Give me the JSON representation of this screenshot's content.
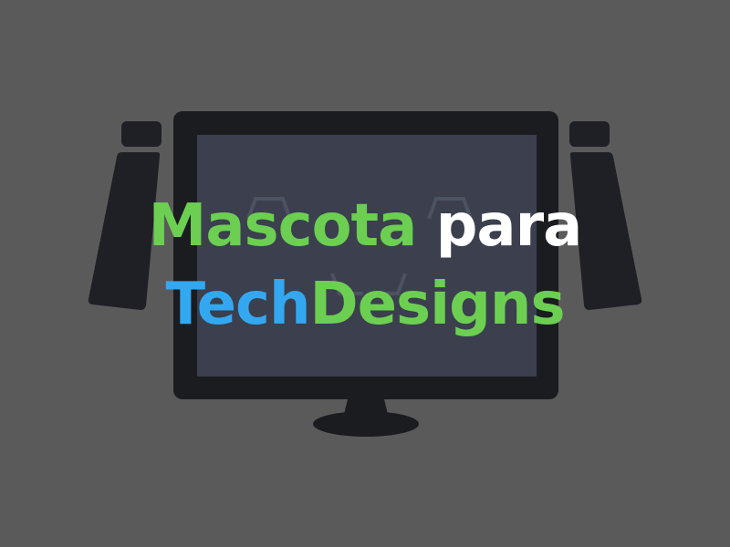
{
  "title": {
    "line1": {
      "word1": "Mascota",
      "word2": "para"
    },
    "line2": {
      "part1": "Tech",
      "part2": "Designs"
    }
  },
  "colors": {
    "background": "#5a5a5a",
    "accent_green": "#6ccf52",
    "accent_blue": "#33a8f0",
    "text_white": "#ffffff",
    "monitor_frame": "#1b1c20",
    "screen": "#3b3f4e"
  },
  "illustration": {
    "icons": [
      "monitor-icon",
      "left-speaker-icon",
      "right-speaker-icon",
      "pixel-face-icon"
    ]
  }
}
